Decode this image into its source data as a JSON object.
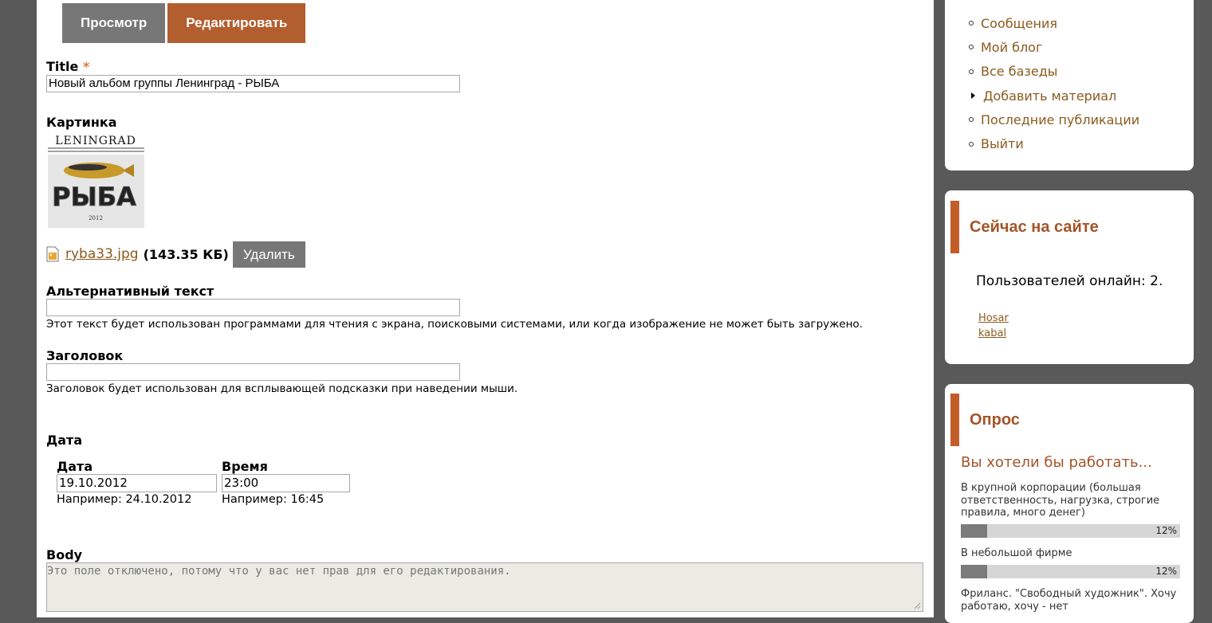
{
  "tabs": {
    "view": "Просмотр",
    "edit": "Редактировать"
  },
  "form": {
    "title_label": "Title",
    "required_mark": "*",
    "title_value": "Новый альбом группы Ленинград - РЫБА",
    "image_label": "Картинка",
    "thumbnail_alt": "LENINGRAD РЫБА",
    "file_name": "ryba33.jpg",
    "file_size": "(143.35 КБ)",
    "delete_label": "Удалить",
    "alt_label": "Альтернативный текст",
    "alt_value": "",
    "alt_help": "Этот текст будет использован программами для чтения с экрана, поисковыми системами, или когда изображение не может быть загружено.",
    "heading_label": "Заголовок",
    "heading_value": "",
    "heading_help": "Заголовок будет использован для всплывающей подсказки при наведении мыши.",
    "date_section_label": "Дата",
    "date_label": "Дата",
    "date_value": "19.10.2012",
    "date_hint": "Например: 24.10.2012",
    "time_label": "Время",
    "time_value": "23:00",
    "time_hint": "Например: 16:45",
    "body_label": "Body",
    "body_disabled_text": "Это поле отключено, потому что у вас нет прав для его редактирования."
  },
  "sidebar": {
    "menu": [
      {
        "label": "Сообщения",
        "marker": "bullet"
      },
      {
        "label": "Мой блог",
        "marker": "bullet"
      },
      {
        "label": "Все базеды",
        "marker": "bullet"
      },
      {
        "label": "Добавить материал",
        "marker": "arrow"
      },
      {
        "label": "Последние публикации",
        "marker": "bullet"
      },
      {
        "label": "Выйти",
        "marker": "bullet"
      }
    ],
    "online": {
      "title": "Сейчас на сайте",
      "text": "Пользователей онлайн: 2.",
      "users": [
        "Hosar",
        "kabal"
      ]
    },
    "poll": {
      "title": "Опрос",
      "question": "Вы хотели бы работать...",
      "options": [
        {
          "text": "В крупной корпорации (большая ответственность, нагрузка, строгие правила, много денег)",
          "percent": 12,
          "percent_label": "12%"
        },
        {
          "text": "В небольшой фирме",
          "percent": 12,
          "percent_label": "12%"
        },
        {
          "text": "Фриланс. \"Свободный художник\". Хочу работаю, хочу - нет"
        }
      ]
    }
  },
  "colors": {
    "accent": "#b35e2e",
    "link": "#8b5a1e",
    "background": "#595959"
  }
}
